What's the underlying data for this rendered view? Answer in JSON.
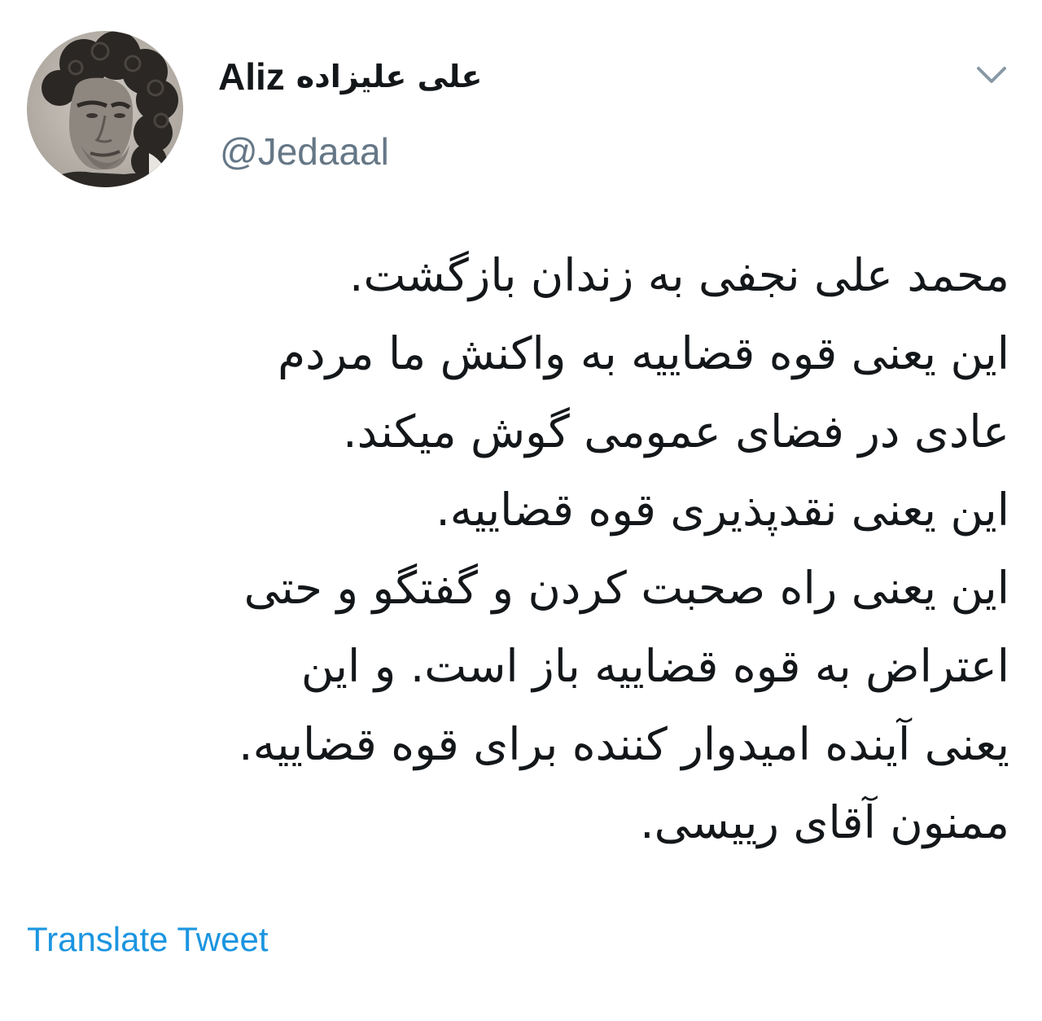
{
  "author": {
    "display_name_latin": "Aliz",
    "display_name_persian": "علی علیزاده",
    "handle": "@Jedaaal"
  },
  "icons": {
    "avatar": "profile-photo",
    "menu": "chevron-down-icon"
  },
  "tweet": {
    "lines": [
      "محمد علی نجفی به زندان بازگشت.",
      "این یعنی قوه قضاییه به واکنش ما مردم",
      "عادی در فضای عمومی گوش میکند.",
      "این یعنی نقدپذیری قوه قضاییه.",
      "این یعنی راه صحبت کردن و گفتگو و حتی",
      "اعتراض به قوه قضاییه باز است. و این",
      "یعنی آینده امیدوار کننده برای قوه قضاییه.",
      "ممنون آقای رییسی."
    ]
  },
  "actions": {
    "translate_label": "Translate Tweet"
  },
  "colors": {
    "text": "#14171a",
    "secondary": "#657786",
    "link": "#1b95e0",
    "chevron": "#8899a6"
  }
}
